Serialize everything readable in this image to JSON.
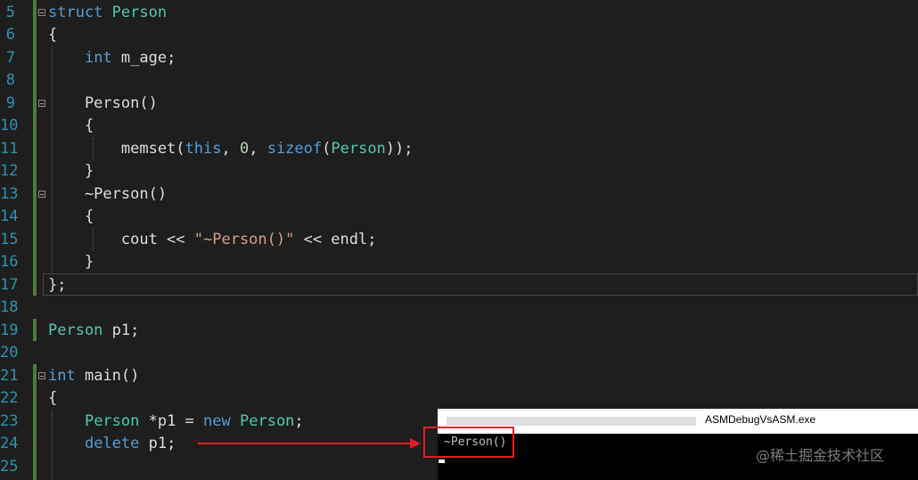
{
  "editor": {
    "lines": [
      {
        "number": "5",
        "tokens": [
          {
            "t": "struct",
            "c": "keyword"
          },
          {
            "t": " ",
            "c": "plain"
          },
          {
            "t": "Person",
            "c": "type"
          }
        ]
      },
      {
        "number": "6",
        "tokens": [
          {
            "t": "{",
            "c": "plain"
          }
        ]
      },
      {
        "number": "7",
        "tokens": [
          {
            "t": "    ",
            "c": "plain"
          },
          {
            "t": "int",
            "c": "keyword"
          },
          {
            "t": " m_age;",
            "c": "plain"
          }
        ]
      },
      {
        "number": "8",
        "tokens": []
      },
      {
        "number": "9",
        "tokens": [
          {
            "t": "    Person()",
            "c": "plain"
          }
        ]
      },
      {
        "number": "10",
        "tokens": [
          {
            "t": "    {",
            "c": "plain"
          }
        ]
      },
      {
        "number": "11",
        "tokens": [
          {
            "t": "        memset(",
            "c": "plain"
          },
          {
            "t": "this",
            "c": "keyword"
          },
          {
            "t": ", ",
            "c": "plain"
          },
          {
            "t": "0",
            "c": "number"
          },
          {
            "t": ", ",
            "c": "plain"
          },
          {
            "t": "sizeof",
            "c": "keyword"
          },
          {
            "t": "(",
            "c": "plain"
          },
          {
            "t": "Person",
            "c": "type"
          },
          {
            "t": "));",
            "c": "plain"
          }
        ]
      },
      {
        "number": "12",
        "tokens": [
          {
            "t": "    }",
            "c": "plain"
          }
        ]
      },
      {
        "number": "13",
        "tokens": [
          {
            "t": "    ~Person()",
            "c": "plain"
          }
        ]
      },
      {
        "number": "14",
        "tokens": [
          {
            "t": "    {",
            "c": "plain"
          }
        ]
      },
      {
        "number": "15",
        "tokens": [
          {
            "t": "        cout << ",
            "c": "plain"
          },
          {
            "t": "\"~Person()\"",
            "c": "string"
          },
          {
            "t": " << endl;",
            "c": "plain"
          }
        ]
      },
      {
        "number": "16",
        "tokens": [
          {
            "t": "    }",
            "c": "plain"
          }
        ]
      },
      {
        "number": "17",
        "tokens": [
          {
            "t": "};",
            "c": "plain"
          }
        ]
      },
      {
        "number": "18",
        "tokens": []
      },
      {
        "number": "19",
        "tokens": [
          {
            "t": "Person",
            "c": "type"
          },
          {
            "t": " p1;",
            "c": "plain"
          }
        ]
      },
      {
        "number": "20",
        "tokens": []
      },
      {
        "number": "21",
        "tokens": [
          {
            "t": "int",
            "c": "keyword"
          },
          {
            "t": " main()",
            "c": "plain"
          }
        ]
      },
      {
        "number": "22",
        "tokens": [
          {
            "t": "{",
            "c": "plain"
          }
        ]
      },
      {
        "number": "23",
        "tokens": [
          {
            "t": "    ",
            "c": "plain"
          },
          {
            "t": "Person",
            "c": "type"
          },
          {
            "t": " *p1 = ",
            "c": "plain"
          },
          {
            "t": "new",
            "c": "keyword"
          },
          {
            "t": " ",
            "c": "plain"
          },
          {
            "t": "Person",
            "c": "type"
          },
          {
            "t": ";",
            "c": "plain"
          }
        ]
      },
      {
        "number": "24",
        "tokens": [
          {
            "t": "    ",
            "c": "plain"
          },
          {
            "t": "delete",
            "c": "keyword"
          },
          {
            "t": " p1;",
            "c": "plain"
          }
        ]
      },
      {
        "number": "25",
        "tokens": []
      }
    ]
  },
  "console": {
    "title": "ASMDebugVsASM.exe",
    "output": "~Person()"
  },
  "watermark": "@稀土掘金技术社区",
  "colors": {
    "keyword": "#569cd6",
    "type": "#4ec9b0",
    "string": "#d69d85",
    "number": "#b5cea8",
    "line_number": "#2b91af",
    "annotation": "#e02020"
  }
}
